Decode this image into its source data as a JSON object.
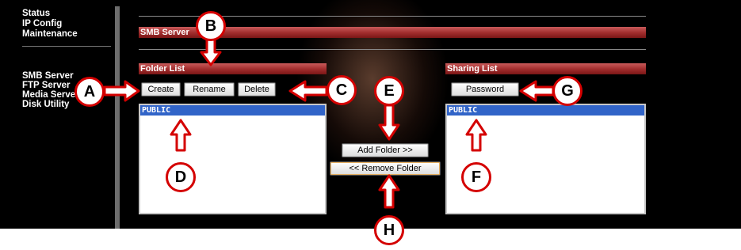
{
  "nav": {
    "items_top": [
      "Status",
      "IP Config",
      "Maintenance"
    ],
    "items_bottom": [
      "SMB Server",
      "FTP Server",
      "Media Server",
      "Disk Utility"
    ]
  },
  "section_title": "SMB Server",
  "folder_list": {
    "header": "Folder List",
    "buttons": {
      "create": "Create",
      "rename": "Rename",
      "delete": "Delete"
    },
    "items": [
      "PUBLIC"
    ]
  },
  "middle_buttons": {
    "add": "Add Folder >>",
    "remove": "<< Remove Folder"
  },
  "sharing_list": {
    "header": "Sharing List",
    "buttons": {
      "password": "Password"
    },
    "items": [
      "PUBLIC"
    ]
  },
  "callouts": {
    "a": "A",
    "b": "B",
    "c": "C",
    "d": "D",
    "e": "E",
    "f": "F",
    "g": "G",
    "h": "H"
  },
  "colors": {
    "accent_red": "#a02c2c",
    "callout_red": "#d40000",
    "selection_blue": "#3164c8"
  }
}
